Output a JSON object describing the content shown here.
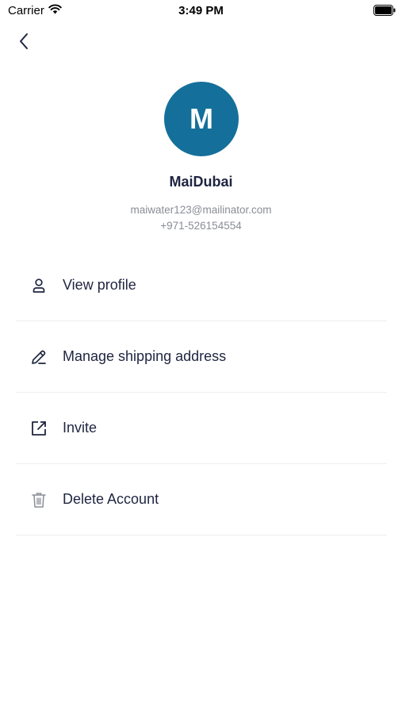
{
  "status_bar": {
    "carrier": "Carrier",
    "time": "3:49 PM"
  },
  "header": {
    "back_icon": "chevron-left-icon"
  },
  "profile": {
    "avatar_initial": "M",
    "avatar_color": "#14709a",
    "name": "MaiDubai",
    "email": "maiwater123@mailinator.com",
    "phone": "+971-526154554"
  },
  "menu": {
    "items": [
      {
        "label": "View profile",
        "icon": "user-icon"
      },
      {
        "label": "Manage shipping address",
        "icon": "pencil-icon"
      },
      {
        "label": "Invite",
        "icon": "external-link-icon"
      },
      {
        "label": "Delete Account",
        "icon": "trash-icon"
      }
    ]
  }
}
